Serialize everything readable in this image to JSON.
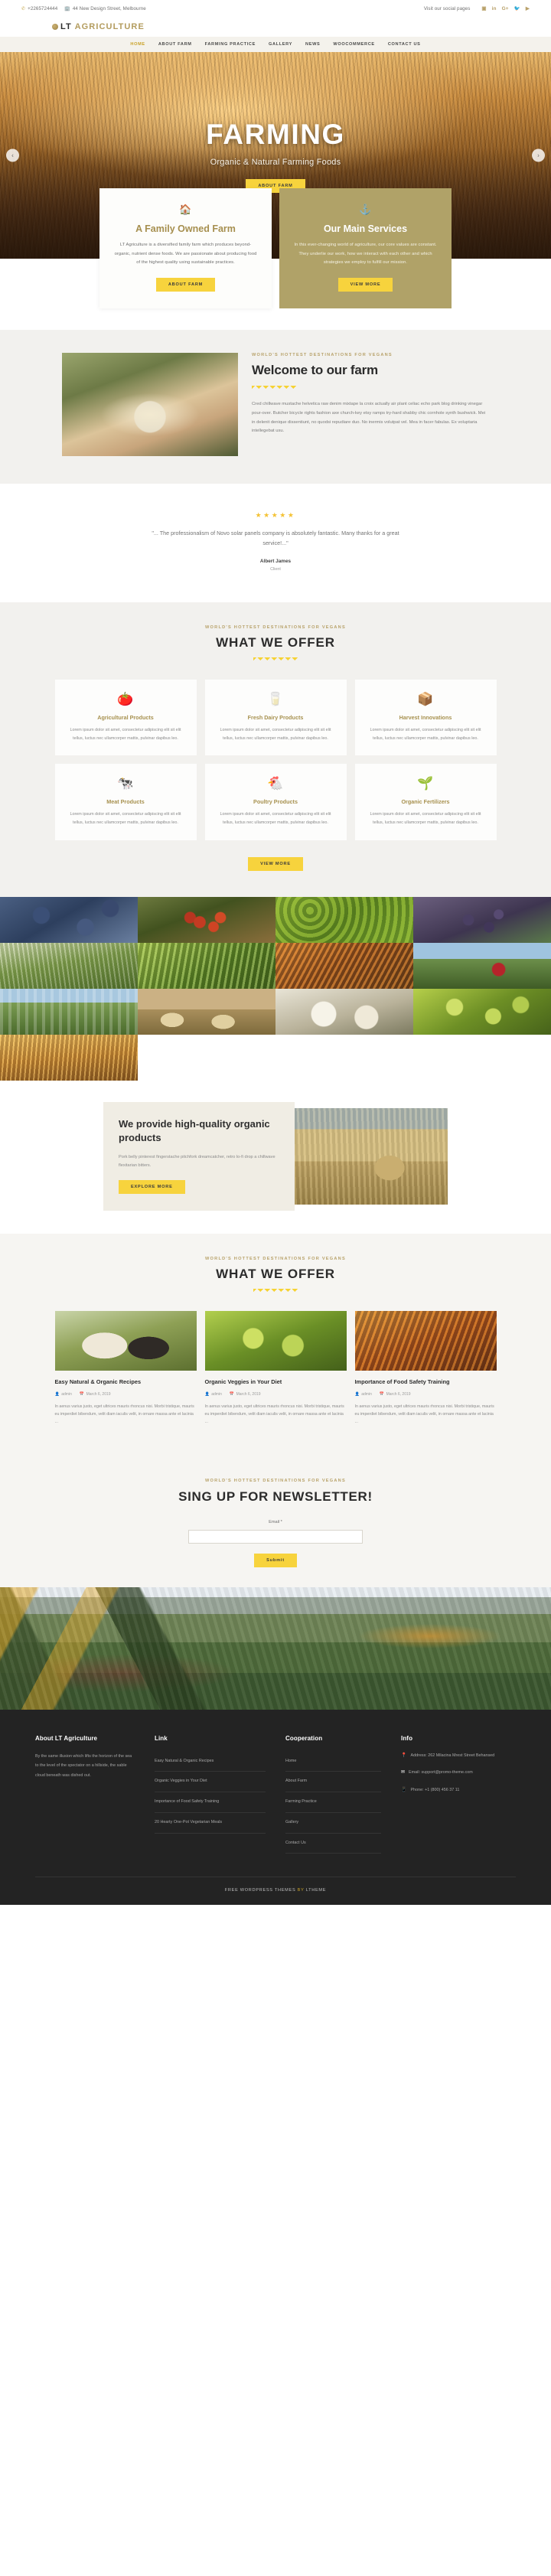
{
  "topbar": {
    "phone": "+2265724444",
    "phone_icon": "headset-icon",
    "address": "44 New Design Street, Melbourne",
    "address_icon": "building-icon",
    "social_label": "Visit our social pages",
    "socials": [
      "instagram",
      "linkedin",
      "google-plus",
      "twitter",
      "youtube"
    ]
  },
  "logo": {
    "part1": "LT",
    "part2": "AGRICULTURE"
  },
  "nav": {
    "items": [
      {
        "label": "HOME",
        "active": true
      },
      {
        "label": "ABOUT FARM",
        "active": false
      },
      {
        "label": "FARMING PRACTICE",
        "active": false
      },
      {
        "label": "GALLERY",
        "active": false
      },
      {
        "label": "NEWS",
        "active": false
      },
      {
        "label": "WOOCOMMERCE",
        "active": false
      },
      {
        "label": "CONTACT US",
        "active": false
      }
    ]
  },
  "hero": {
    "title": "FARMING",
    "subtitle": "Organic & Natural Farming Foods",
    "button": "ABOUT FARM",
    "prev": "‹",
    "next": "›"
  },
  "cards": [
    {
      "icon": "🏠",
      "title": "A Family Owned Farm",
      "text": "LT Agriculture is a diversified family farm which produces beyond-organic, nutrient dense foods. We are passionate about producing food of the highest quality using sustainable practices.",
      "button": "ABOUT FARM"
    },
    {
      "icon": "⚓",
      "title": "Our Main Services",
      "text": "In this ever-changing world of agriculture, our core values are constant. They underlie our work, how we interact with each other and which strategies we employ to fulfill our mission.",
      "button": "VIEW MORE"
    }
  ],
  "welcome": {
    "eyebrow": "WORLD'S HOTTEST DESTINATIONS FOR VEGANS",
    "title": "Welcome to our farm",
    "text": "Cred chillwave mustache helvetica raw denim mixtape la croix actually air plant celiac echo park blog drinking vinegar pour-over. Butcher bicycle rights fashion axe church-key etsy ramps try-hard shabby chic cornhole synth bushwick. Mei in delenit denique dissentiunt, no quodsi repudiare duo. No inermis volutpat vel. Mea in facer fabulas. Ex voluptaria intellegebat usu.",
    "image": "hands-holding-grain-photo"
  },
  "testimonial": {
    "stars": "★★★★★",
    "quote": "\"... The professionalism of Novo solar panels company is absolutely fantastic. Many thanks for a great service!...\"",
    "name": "Albert James",
    "role": "Client"
  },
  "offer": {
    "eyebrow": "WORLD'S HOTTEST DESTINATIONS FOR VEGANS",
    "title": "WHAT WE OFFER",
    "button": "VIEW MORE",
    "services": [
      {
        "icon": "🍅",
        "title": "Agricultural Products",
        "text": "Lorem ipsum dolor sit amet, consectetur adipiscing elit sit elit tellus, luctus nec ullamcorper mattis, pulvinar dapibus leo."
      },
      {
        "icon": "🥛",
        "title": "Fresh Dairy Products",
        "text": "Lorem ipsum dolor sit amet, consectetur adipiscing elit sit elit tellus, luctus nec ullamcorper mattis, pulvinar dapibus leo."
      },
      {
        "icon": "📦",
        "title": "Harvest Innovations",
        "text": "Lorem ipsum dolor sit amet, consectetur adipiscing elit sit elit tellus, luctus nec ullamcorper mattis, pulvinar dapibus leo."
      },
      {
        "icon": "🐄",
        "title": "Meat Products",
        "text": "Lorem ipsum dolor sit amet, consectetur adipiscing elit sit elit tellus, luctus nec ullamcorper mattis, pulvinar dapibus leo."
      },
      {
        "icon": "🐔",
        "title": "Poultry Products",
        "text": "Lorem ipsum dolor sit amet, consectetur adipiscing elit sit elit tellus, luctus nec ullamcorper mattis, pulvinar dapibus leo."
      },
      {
        "icon": "🌱",
        "title": "Organic Fertilizers",
        "text": "Lorem ipsum dolor sit amet, consectetur adipiscing elit sit elit tellus, luctus nec ullamcorper mattis, pulvinar dapibus leo."
      }
    ]
  },
  "gallery": {
    "items": [
      "blueberries-photo",
      "hands-with-cherry-tomatoes-photo",
      "green-vegetables-photo",
      "grapes-on-vine-photo",
      "lettuce-field-photo",
      "leek-harvest-photo",
      "carrots-and-spices-photo",
      "tractor-in-field-photo",
      "hay-bales-field-photo",
      "sheep-flock-photo",
      "green-tomatoes-photo",
      "cattle-at-sunset-photo"
    ]
  },
  "hq": {
    "title": "We provide high-quality organic products",
    "text": "Pork belly pinterest fingerstache pitchfork dreamcatcher, retro lo-fi drop a chillwave flexitarian bitters.",
    "button": "EXPLORE MORE",
    "image": "hay-bale-field-photo"
  },
  "blog": {
    "eyebrow": "WORLD'S HOTTEST DESTINATIONS FOR VEGANS",
    "title": "WHAT WE OFFER",
    "posts": [
      {
        "image": "cows-in-pasture-photo",
        "title": "Easy Natural & Organic Recipes",
        "author_icon": "user-icon",
        "author": "admin",
        "date_icon": "calendar-icon",
        "date": "March 6, 2019",
        "text": "In aenus varius justo, eget ultrices mauris rhoncus nisi. Morbi tristique, mauris eu imperdiet bibendum, velit diam iaculis velit, in ornare massa ante et lacinia ..."
      },
      {
        "image": "green-vegetables-photo",
        "title": "Organic Veggies in Your Diet",
        "author_icon": "user-icon",
        "author": "admin",
        "date_icon": "calendar-icon",
        "date": "March 6, 2019",
        "text": "In aenus varius justo, eget ultrices mauris rhoncus nisi. Morbi tristique, mauris eu imperdiet bibendum, velit diam iaculis velit, in ornare massa ante et lacinia ..."
      },
      {
        "image": "spices-and-carrots-photo",
        "title": "Importance of Food Safety Training",
        "author_icon": "user-icon",
        "author": "admin",
        "date_icon": "calendar-icon",
        "date": "March 6, 2019",
        "text": "In aenus varius justo, eget ultrices mauris rhoncus nisi. Morbi tristique, mauris eu imperdiet bibendum, velit diam iaculis velit, in ornare massa ante et lacinia ..."
      }
    ]
  },
  "newsletter": {
    "eyebrow": "WORLD'S HOTTEST DESTINATIONS FOR VEGANS",
    "title": "SING UP FOR NEWSLETTER!",
    "field_label": "Email *",
    "input_value": "",
    "input_placeholder": "",
    "button": "Submit"
  },
  "footer_image": "mountain-valley-farmland-photo",
  "footer": {
    "about": {
      "heading": "About LT Agriculture",
      "text": "By the same illusion which lifts the horizon of the sea to the level of the spectator on a hillside, the sable cloud beneath was dished out."
    },
    "link": {
      "heading": "Link",
      "items": [
        "Easy Natural & Organic Recipes",
        "Organic Veggies in Your Diet",
        "Importance of Food Safety Training",
        "20 Hearty One-Pot Vegetarian Meals"
      ]
    },
    "cooperation": {
      "heading": "Cooperation",
      "items": [
        "Home",
        "About Farm",
        "Farming Practice",
        "Gallery",
        "Contact Us"
      ]
    },
    "info": {
      "heading": "Info",
      "items": [
        {
          "icon": "📍",
          "icon_name": "location-pin-icon",
          "text": "Address: 262 Milacina Mrest Street Behansed"
        },
        {
          "icon": "✉",
          "icon_name": "envelope-icon",
          "text": "Email: support@promo-theme.com"
        },
        {
          "icon": "📱",
          "icon_name": "phone-icon",
          "text": "Phone: +1 (800) 456 37 11"
        }
      ]
    },
    "bottom_pre": "FREE WORDPRESS THEMES",
    "bottom_by": "BY",
    "bottom_brand": "LTHEME"
  },
  "colors": {
    "accent_yellow": "#f7d33d",
    "gold": "#b39c5e",
    "olive": "#b0a268",
    "dark": "#232323"
  }
}
